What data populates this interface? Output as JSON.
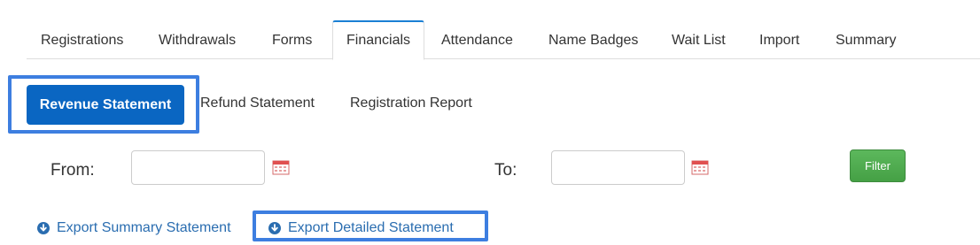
{
  "tabs": [
    {
      "label": "Registrations"
    },
    {
      "label": "Withdrawals"
    },
    {
      "label": "Forms"
    },
    {
      "label": "Financials",
      "active": true
    },
    {
      "label": "Attendance"
    },
    {
      "label": "Name Badges"
    },
    {
      "label": "Wait List"
    },
    {
      "label": "Import"
    },
    {
      "label": "Summary"
    }
  ],
  "subtabs": {
    "revenue": "Revenue Statement",
    "refund": "Refund Statement",
    "registration": "Registration Report"
  },
  "filters": {
    "from_label": "From:",
    "from_value": "",
    "to_label": "To:",
    "to_value": "",
    "filter_button": "Filter"
  },
  "exports": {
    "summary": "Export Summary Statement",
    "detailed": "Export Detailed Statement"
  },
  "colors": {
    "primary": "#0a66c2",
    "tab_accent": "#1a7fd4",
    "highlight": "#3d7ee0",
    "filter_green": "#5cb85c",
    "link": "#2a6db0"
  },
  "icons": {
    "calendar": "calendar-icon",
    "download": "download-circle-icon"
  }
}
